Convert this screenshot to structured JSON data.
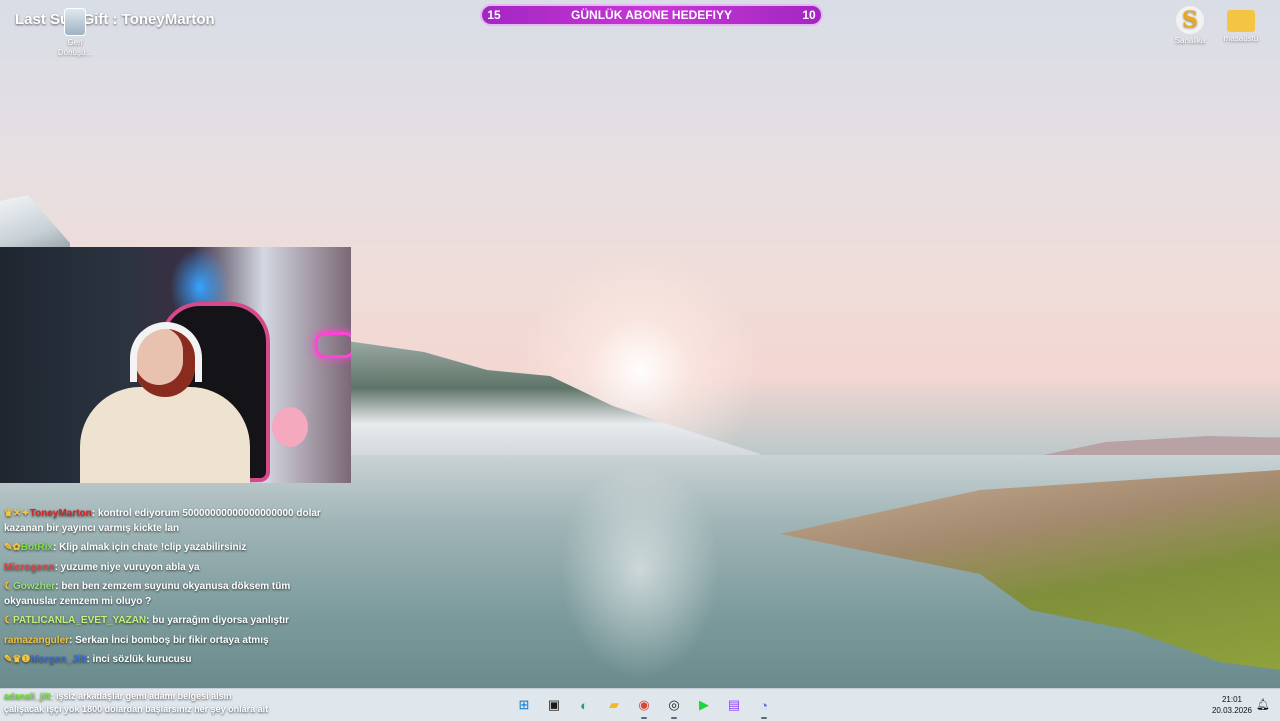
{
  "overlay": {
    "last_sub_gift": "Last Sub Gift : ToneyMarton",
    "sub_goal": {
      "left": "15",
      "title": "GÜNLÜK ABONE HEDEFIYY",
      "right": "10"
    }
  },
  "desktop_icons": [
    {
      "label_line1": "Geri",
      "label_line2": "Dönüşü...",
      "icon": "recycle-bin-icon"
    },
    {
      "label": "Sanalika",
      "icon": "sanalika-icon",
      "glyph": "S"
    },
    {
      "label": "masaüstü",
      "icon": "folder-icon"
    }
  ],
  "chat": [
    {
      "user": "ToneyMarton",
      "user_color": "#e02020",
      "badges": "♛✕✦",
      "text": "kontrol ediyorum 50000000000000000000 dolar kazanan bir yayıncı varmış kickte lan"
    },
    {
      "user": "BotRix",
      "user_color": "#7fe04a",
      "badges": "✎✿",
      "text": "Klip almak için chate !clip yazabilirsiniz"
    },
    {
      "user": "Microgenn",
      "user_color": "#ff3a3a",
      "badges": "",
      "text": "yuzume niye vuruyon abla ya"
    },
    {
      "user": "Gowzher",
      "user_color": "#9be07a",
      "badges": "☾",
      "text": "ben ben zemzem suyunu okyanusa döksem tüm okyanuslar zemzem mi oluyo ?"
    },
    {
      "user": "PATLICANLA_EVET_YAZAN",
      "user_color": "#c8f07a",
      "badges": "☾",
      "text": "bu yarrağım diyorsa yanlıştır"
    },
    {
      "user": "ramazanguler",
      "user_color": "#f0c040",
      "badges": "",
      "text": "Serkan İnci bomboş bir fikir ortaya atmış"
    },
    {
      "user": "Morgen_Jilt",
      "user_color": "#3a6fe0",
      "badges": "✎♛❶",
      "text": "inci sözlük kurucusu"
    }
  ],
  "taskbar_chat": [
    {
      "user": "adanali_jilt",
      "user_color": "#7fe04a",
      "text": "işsiz arkadaşlar gemi adamı belgesi alsın"
    },
    {
      "user": "",
      "user_color": "#ffffff",
      "text": "çalışacak işçi yok 1800 dolardan başlarsınız her şey onlara ait"
    }
  ],
  "taskbar": {
    "icons": [
      {
        "name": "windows-start-icon",
        "glyph": "⊞",
        "color": "#0078d4"
      },
      {
        "name": "file-explorer-icon",
        "glyph": "▣",
        "color": "#1a1a1a"
      },
      {
        "name": "edge-browser-icon",
        "glyph": "◐",
        "color": "#1fa07a"
      },
      {
        "name": "folder-icon",
        "glyph": "▰",
        "color": "#f2b828"
      },
      {
        "name": "chrome-icon",
        "glyph": "◉",
        "color": "#db4437"
      },
      {
        "name": "obs-icon",
        "glyph": "◎",
        "color": "#222222"
      },
      {
        "name": "kick-icon",
        "glyph": "▶",
        "color": "#1fd63a"
      },
      {
        "name": "twitch-icon",
        "glyph": "▤",
        "color": "#9146ff"
      },
      {
        "name": "discord-icon",
        "glyph": "◔",
        "color": "#5865f2"
      }
    ],
    "time": "21:01",
    "date": "20.03.2026"
  }
}
